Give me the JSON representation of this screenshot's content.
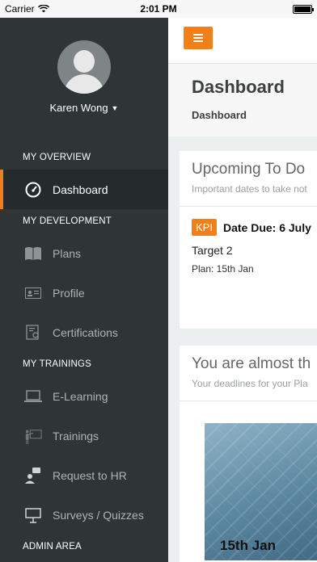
{
  "status": {
    "carrier": "Carrier",
    "time": "2:01 PM"
  },
  "sidebar": {
    "user_name": "Karen Wong",
    "sections": [
      {
        "label": "MY OVERVIEW"
      },
      {
        "label": "MY DEVELOPMENT"
      },
      {
        "label": "MY TRAININGS"
      },
      {
        "label": "ADMIN AREA"
      }
    ],
    "items": [
      {
        "label": "Dashboard",
        "icon": "gauge-icon"
      },
      {
        "label": "Plans",
        "icon": "book-icon"
      },
      {
        "label": "Profile",
        "icon": "id-card-icon"
      },
      {
        "label": "Certifications",
        "icon": "certificate-icon"
      },
      {
        "label": "E-Learning",
        "icon": "laptop-icon"
      },
      {
        "label": "Trainings",
        "icon": "presenter-icon"
      },
      {
        "label": "Request to HR",
        "icon": "user-chat-icon"
      },
      {
        "label": "Surveys / Quizzes",
        "icon": "easel-icon"
      }
    ]
  },
  "main": {
    "page_title": "Dashboard",
    "breadcrumb": "Dashboard",
    "todo": {
      "title": "Upcoming To Do",
      "subtitle": "Important dates to take not",
      "badge": "KPI",
      "due": "Date Due: 6 July",
      "target": "Target 2",
      "plan": "Plan: 15th Jan"
    },
    "deadline": {
      "title": "You are almost th",
      "subtitle": "Your deadlines for your Pla",
      "banner_date": "15th Jan"
    }
  },
  "colors": {
    "accent": "#f27f17",
    "sidebar_bg": "#2f3537"
  }
}
